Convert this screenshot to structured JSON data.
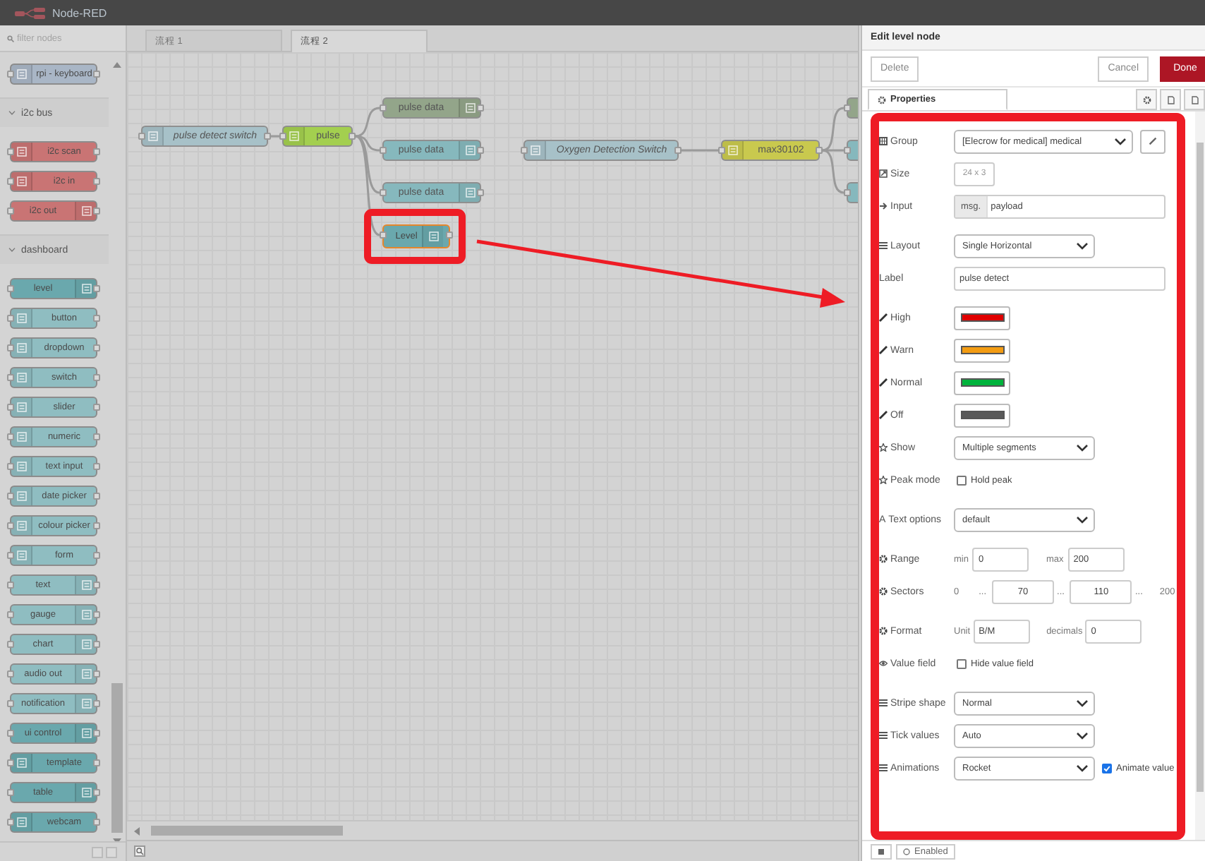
{
  "header": {
    "title": "Node-RED"
  },
  "palette": {
    "filter_placeholder": "filter nodes",
    "top_nodes": [
      {
        "label": "rpi - keyboard",
        "color": "#a9b6c6",
        "kind": "left"
      }
    ],
    "categories": [
      {
        "name": "i2c bus",
        "expanded": true,
        "nodes": [
          {
            "label": "i2c scan",
            "color": "#c97474",
            "kind": "left"
          },
          {
            "label": "i2c in",
            "color": "#c97474",
            "kind": "left"
          },
          {
            "label": "i2c out",
            "color": "#c97474",
            "kind": "right"
          }
        ]
      },
      {
        "name": "dashboard",
        "expanded": true,
        "nodes": [
          {
            "label": "level",
            "color": "#6aa8ad",
            "kind": "right"
          },
          {
            "label": "button",
            "color": "#8fbdc1",
            "kind": "left"
          },
          {
            "label": "dropdown",
            "color": "#8fbdc1",
            "kind": "left"
          },
          {
            "label": "switch",
            "color": "#8fbdc1",
            "kind": "left"
          },
          {
            "label": "slider",
            "color": "#8fbdc1",
            "kind": "left"
          },
          {
            "label": "numeric",
            "color": "#8fbdc1",
            "kind": "left"
          },
          {
            "label": "text input",
            "color": "#8fbdc1",
            "kind": "left"
          },
          {
            "label": "date picker",
            "color": "#8fbdc1",
            "kind": "left"
          },
          {
            "label": "colour picker",
            "color": "#8fbdc1",
            "kind": "left"
          },
          {
            "label": "form",
            "color": "#8fbdc1",
            "kind": "left"
          },
          {
            "label": "text",
            "color": "#8fbdc1",
            "kind": "right"
          },
          {
            "label": "gauge",
            "color": "#8fbdc1",
            "kind": "right"
          },
          {
            "label": "chart",
            "color": "#8fbdc1",
            "kind": "right"
          },
          {
            "label": "audio out",
            "color": "#8fbdc1",
            "kind": "right"
          },
          {
            "label": "notification",
            "color": "#8fbdc1",
            "kind": "right"
          },
          {
            "label": "ui control",
            "color": "#6aa8ad",
            "kind": "right"
          },
          {
            "label": "template",
            "color": "#6aa8ad",
            "kind": "left"
          },
          {
            "label": "table",
            "color": "#6aa8ad",
            "kind": "right"
          },
          {
            "label": "webcam",
            "color": "#6aa8ad",
            "kind": "left"
          }
        ]
      }
    ]
  },
  "workspace_tabs": [
    {
      "label": "流程 1",
      "selected": false
    },
    {
      "label": "流程 2",
      "selected": true
    }
  ],
  "canvas": {
    "nodes": [
      {
        "label": "pulse detect switch",
        "color": "#a7c1c8",
        "kind": "left",
        "italic": true,
        "selected": false
      },
      {
        "label": "pulse",
        "color": "#a3cf4f",
        "kind": "left",
        "italic": false,
        "selected": false
      },
      {
        "label": "pulse data",
        "color": "#93a58a",
        "kind": "right",
        "italic": false,
        "selected": false
      },
      {
        "label": "pulse data",
        "color": "#86b8bd",
        "kind": "right",
        "italic": false,
        "selected": false
      },
      {
        "label": "pulse data",
        "color": "#86b8bd",
        "kind": "right",
        "italic": false,
        "selected": false
      },
      {
        "label": "Level",
        "color": "#6aa8ad",
        "kind": "right",
        "italic": false,
        "selected": true
      },
      {
        "label": "Oxygen Detection Switch",
        "color": "#a7c1c8",
        "kind": "left",
        "italic": true,
        "selected": false
      },
      {
        "label": "max30102",
        "color": "#c9c94e",
        "kind": "left",
        "italic": false,
        "selected": false
      },
      {
        "color": "#93a58a",
        "selected": false
      },
      {
        "color": "#86b8bd",
        "selected": false
      },
      {
        "color": "#86b8bd",
        "selected": false
      }
    ]
  },
  "editor": {
    "title": "Edit level node",
    "buttons": [
      {
        "label": "Delete",
        "kind": "secondary"
      },
      {
        "label": "Cancel",
        "kind": "secondary"
      },
      {
        "label": "Done",
        "kind": "primary"
      }
    ],
    "tabs": [
      {
        "label": "Properties",
        "selected": true
      },
      {
        "selected": false
      },
      {
        "selected": false
      },
      {
        "selected": false
      }
    ],
    "sections": [
      [
        {
          "label": "Group",
          "kind": "select",
          "value": "[Elecrow for medical] medical",
          "edit_button": true
        },
        {
          "label": "Size",
          "kind": "button",
          "value": "24 x 3"
        },
        {
          "label": "Input",
          "kind": "typed",
          "prefix": "msg.",
          "value": "payload"
        }
      ],
      [
        {
          "label": "Layout",
          "kind": "select",
          "value": "Single Horizontal"
        },
        {
          "label": "Label",
          "kind": "text",
          "value": "pulse detect"
        }
      ],
      [
        {
          "label": "High",
          "kind": "color",
          "color": "#e00000"
        },
        {
          "label": "Warn",
          "kind": "color",
          "color": "#f39c12"
        },
        {
          "label": "Normal",
          "kind": "color",
          "color": "#00b33c"
        },
        {
          "label": "Off",
          "kind": "color",
          "color": "#595959"
        },
        {
          "label": "Show",
          "kind": "select",
          "value": "Multiple segments"
        },
        {
          "label": "Peak mode",
          "kind": "checkbox",
          "text": "Hold peak",
          "checked": false
        }
      ],
      [
        {
          "label": "Text options",
          "glyph": "A",
          "kind": "select",
          "value": "default"
        }
      ],
      [
        {
          "label": "Range",
          "kind": "range",
          "min_label": "min",
          "min": "0",
          "max_label": "max",
          "max": "200"
        },
        {
          "label": "Sectors",
          "kind": "sectors",
          "items": [
            {
              "kind": "text",
              "value": "0"
            },
            {
              "kind": "text",
              "value": "..."
            },
            {
              "kind": "input",
              "value": "70"
            },
            {
              "kind": "text",
              "value": "..."
            },
            {
              "kind": "input",
              "value": "110"
            },
            {
              "kind": "text",
              "value": "..."
            },
            {
              "kind": "text",
              "value": "200"
            }
          ]
        }
      ],
      [
        {
          "label": "Format",
          "kind": "format",
          "unit_label": "Unit",
          "unit": "B/M",
          "decimals_label": "decimals",
          "decimals": "0"
        },
        {
          "label": "Value field",
          "kind": "checkbox",
          "text": "Hide value field",
          "checked": false
        }
      ],
      [
        {
          "label": "Stripe shape",
          "kind": "select",
          "value": "Normal"
        },
        {
          "label": "Tick values",
          "kind": "select",
          "value": "Auto"
        },
        {
          "label": "Animations",
          "kind": "select",
          "value": "Rocket",
          "checkbox": {
            "text": "Animate value",
            "checked": true
          }
        }
      ]
    ],
    "footer": {
      "enabled_label": "Enabled"
    }
  }
}
